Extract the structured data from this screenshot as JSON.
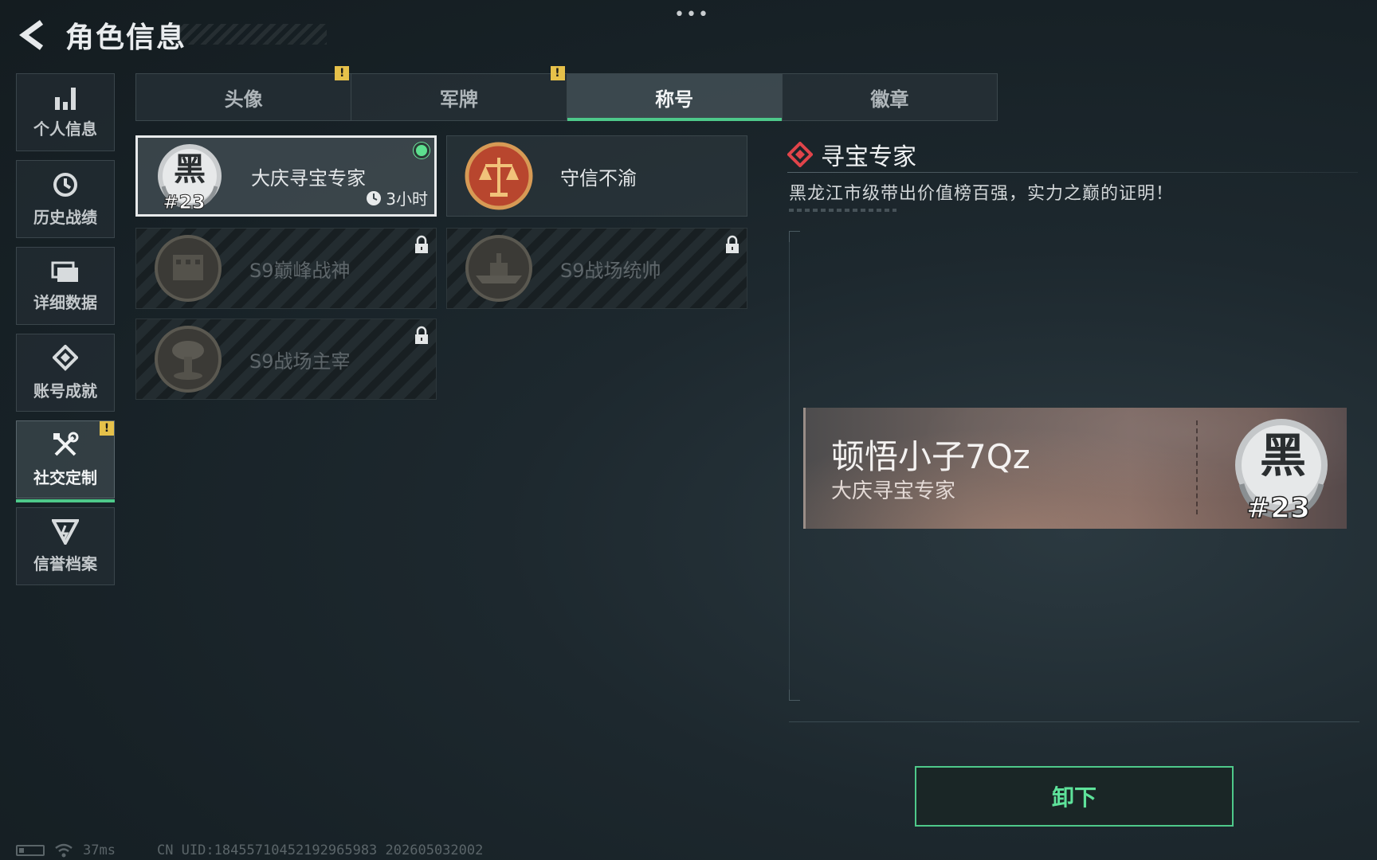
{
  "header": {
    "title": "角色信息"
  },
  "nav": {
    "items": [
      {
        "label": "个人信息",
        "icon": "bar-chart-icon"
      },
      {
        "label": "历史战绩",
        "icon": "history-clock-icon"
      },
      {
        "label": "详细数据",
        "icon": "folder-icon"
      },
      {
        "label": "账号成就",
        "icon": "achievement-icon"
      },
      {
        "label": "社交定制",
        "icon": "tools-icon",
        "active": true,
        "alert": "!"
      },
      {
        "label": "信誉档案",
        "icon": "reputation-icon"
      }
    ]
  },
  "tabs": [
    {
      "label": "头像",
      "alert": "!"
    },
    {
      "label": "军牌",
      "alert": "!"
    },
    {
      "label": "称号",
      "active": true
    },
    {
      "label": "徽章"
    }
  ],
  "titles": [
    {
      "name": "大庆寻宝专家",
      "badge_text": "黑",
      "badge_rank": "#23",
      "timer": "3小时",
      "selected": true,
      "equipped": true
    },
    {
      "name": "守信不渝",
      "badge_icon": "scales-icon"
    },
    {
      "name": "S9巅峰战神",
      "locked": true
    },
    {
      "name": "S9战场统帅",
      "locked": true
    },
    {
      "name": "S9战场主宰",
      "locked": true
    }
  ],
  "detail": {
    "title": "寻宝专家",
    "description": "黑龙江市级带出价值榜百强，实力之巅的证明！"
  },
  "plate": {
    "player_name": "顿悟小子7Qz",
    "title": "大庆寻宝专家",
    "badge_text": "黑",
    "badge_rank": "#23"
  },
  "actions": {
    "unequip_label": "卸下"
  },
  "footer": {
    "ping": "37ms",
    "uid": "CN UID:1845571045219296598​3 202605032002"
  },
  "colors": {
    "accent": "#4ec98a",
    "warning": "#e6c14a",
    "detail_diamond": "#e0444a"
  }
}
